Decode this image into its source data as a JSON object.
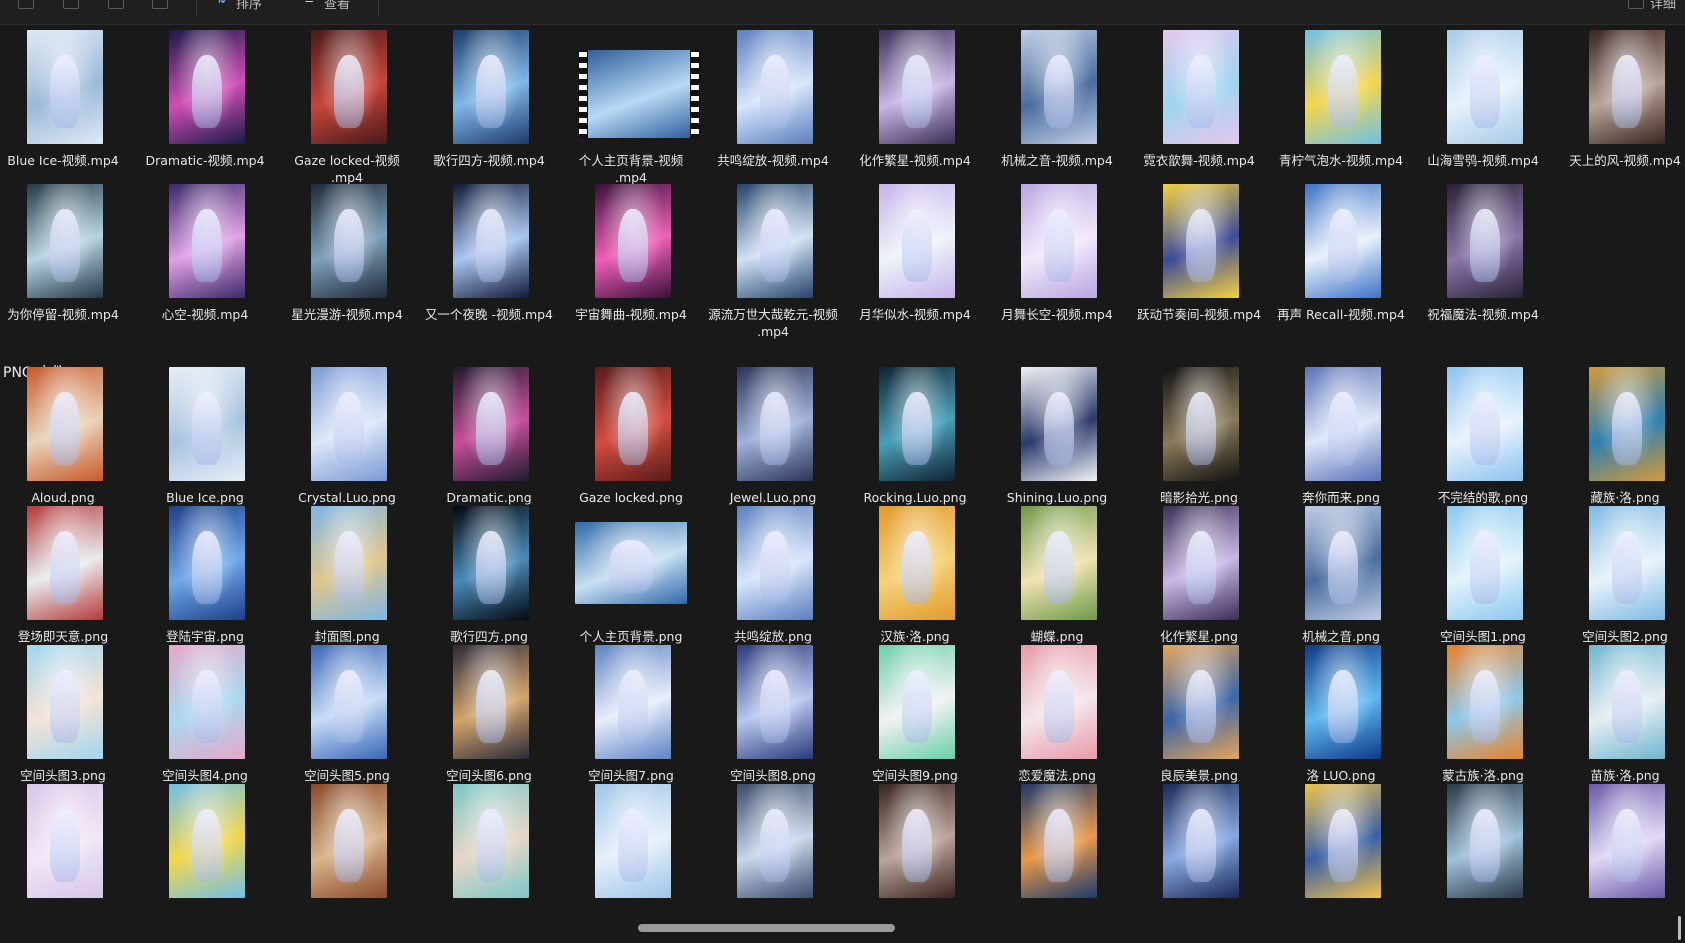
{
  "toolbar": {
    "sort_label": "排序",
    "view_label": "查看",
    "details_label": "详细"
  },
  "groups": {
    "png_header": "PNG 文件"
  },
  "mp4_files": [
    {
      "name": "Blue Ice-视频.mp4",
      "colors": [
        "#dfe9f5",
        "#9ab8d8"
      ]
    },
    {
      "name": "Dramatic-视频.mp4",
      "colors": [
        "#1a1a4a",
        "#d04fb5"
      ]
    },
    {
      "name": "Gaze locked-视频.mp4",
      "colors": [
        "#4a1a1a",
        "#c7453a"
      ]
    },
    {
      "name": "歌行四方-视频.mp4",
      "colors": [
        "#1d3b6b",
        "#7fb7e8"
      ]
    },
    {
      "name": "个人主页背景-视频.mp4",
      "colors": [
        "#2f5f9a",
        "#b9d9f5"
      ]
    },
    {
      "name": "共鸣绽放-视频.mp4",
      "colors": [
        "#5b7fc0",
        "#d7e6fb"
      ]
    },
    {
      "name": "化作繁星-视频.mp4",
      "colors": [
        "#3a2f55",
        "#c9b7e6"
      ]
    },
    {
      "name": "机械之音-视频.mp4",
      "colors": [
        "#bfcde6",
        "#4a6c9e"
      ]
    },
    {
      "name": "霓衣歆舞-视频.mp4",
      "colors": [
        "#e4c7ee",
        "#9fd4ef"
      ]
    },
    {
      "name": "青柠气泡水-视频.mp4",
      "colors": [
        "#6fc0ea",
        "#f4d64a"
      ]
    },
    {
      "name": "山海雪鸮-视频.mp4",
      "colors": [
        "#a8cbe8",
        "#e6f2fb"
      ]
    },
    {
      "name": "天上的风-视频.mp4",
      "colors": [
        "#3a2420",
        "#b9a49a"
      ]
    },
    {
      "name": "为你停留-视频.mp4",
      "colors": [
        "#243947",
        "#b6d3df"
      ]
    },
    {
      "name": "心空-视频.mp4",
      "colors": [
        "#3b2a6a",
        "#e1a0e6"
      ]
    },
    {
      "name": "星光漫游-视频.mp4",
      "colors": [
        "#1e2a3a",
        "#7fa0b9"
      ]
    },
    {
      "name": "又一个夜晚 -视频.mp4",
      "colors": [
        "#101a38",
        "#a9c5f0"
      ]
    },
    {
      "name": "宇宙舞曲-视频.mp4",
      "colors": [
        "#3a0f3a",
        "#ef5fb6"
      ]
    },
    {
      "name": "源流万世大哉乾元-视频.mp4",
      "colors": [
        "#25446b",
        "#cfe2f3"
      ]
    },
    {
      "name": "月华似水-视频.mp4",
      "colors": [
        "#c6b3ea",
        "#eef3fb"
      ]
    },
    {
      "name": "月舞长空-视频.mp4",
      "colors": [
        "#b9a6e0",
        "#f1e9fb"
      ]
    },
    {
      "name": "跃动节奏间-视频.mp4",
      "colors": [
        "#f5d23c",
        "#3b4a9a"
      ]
    },
    {
      "name": "再声 Recall-视频.mp4",
      "colors": [
        "#3d73c6",
        "#e8f0fb"
      ]
    },
    {
      "name": "祝福魔法-视频.mp4",
      "colors": [
        "#2a2238",
        "#8a76a8"
      ]
    }
  ],
  "png_files": [
    {
      "name": "Aloud.png",
      "colors": [
        "#c85a2a",
        "#e8d2b8"
      ]
    },
    {
      "name": "Blue Ice.png",
      "colors": [
        "#e6eef7",
        "#a9c3df"
      ]
    },
    {
      "name": "Crystal.Luo.png",
      "colors": [
        "#7c9ad6",
        "#dce7f7"
      ]
    },
    {
      "name": "Dramatic.png",
      "colors": [
        "#1f1a2e",
        "#c64f9a"
      ]
    },
    {
      "name": "Gaze locked.png",
      "colors": [
        "#5a1a1a",
        "#d34c40"
      ]
    },
    {
      "name": "Jewel.Luo.png",
      "colors": [
        "#2c3558",
        "#9fb2d9"
      ]
    },
    {
      "name": "Rocking.Luo.png",
      "colors": [
        "#102231",
        "#4aa0b9"
      ]
    },
    {
      "name": "Shining.Luo.png",
      "colors": [
        "#f1f3f8",
        "#2a3a6a"
      ]
    },
    {
      "name": "暗影拾光.png",
      "colors": [
        "#121212",
        "#8a7a5a"
      ]
    },
    {
      "name": "奔你而来.png",
      "colors": [
        "#5a72b9",
        "#dde6f7"
      ]
    },
    {
      "name": "不完结的歌.png",
      "colors": [
        "#8cc2f0",
        "#e8f3fc"
      ]
    },
    {
      "name": "藏族·洛.png",
      "colors": [
        "#d49a3a",
        "#2f7fb0"
      ]
    },
    {
      "name": "登场即天意.png",
      "colors": [
        "#b53a3a",
        "#e8ecef"
      ]
    },
    {
      "name": "登陆宇宙.png",
      "colors": [
        "#1e3f8a",
        "#6fa8e8"
      ]
    },
    {
      "name": "封面图.png",
      "colors": [
        "#7fb6e6",
        "#e0c58a"
      ]
    },
    {
      "name": "歌行四方.png",
      "colors": [
        "#04080f",
        "#4a8ab9"
      ]
    },
    {
      "name": "个人主页背景.png",
      "colors": [
        "#2f69ab",
        "#c8dff2"
      ]
    },
    {
      "name": "共鸣绽放.png",
      "colors": [
        "#5b7fc0",
        "#d7e6fb"
      ]
    },
    {
      "name": "汉族·洛.png",
      "colors": [
        "#e49a2a",
        "#f3d27a"
      ]
    },
    {
      "name": "蝴蝶.png",
      "colors": [
        "#6e9a4a",
        "#f1e2b0"
      ]
    },
    {
      "name": "化作繁星.png",
      "colors": [
        "#3a2f55",
        "#c9b7e6"
      ]
    },
    {
      "name": "机械之音.png",
      "colors": [
        "#bfcde6",
        "#4a6c9e"
      ]
    },
    {
      "name": "空间头图1.png",
      "colors": [
        "#8cc8ef",
        "#e3f3fc"
      ]
    },
    {
      "name": "空间头图2.png",
      "colors": [
        "#7fb9e3",
        "#e8f3fa"
      ]
    },
    {
      "name": "空间头图3.png",
      "colors": [
        "#9fd6ef",
        "#f6e2d6"
      ]
    },
    {
      "name": "空间头图4.png",
      "colors": [
        "#e6a8c8",
        "#a8d8ef"
      ]
    },
    {
      "name": "空间头图5.png",
      "colors": [
        "#3a66b9",
        "#c6dbf5"
      ]
    },
    {
      "name": "空间头图6.png",
      "colors": [
        "#2a2a3a",
        "#d4a46a"
      ]
    },
    {
      "name": "空间头图7.png",
      "colors": [
        "#5e82c6",
        "#e8eefa"
      ]
    },
    {
      "name": "空间头图8.png",
      "colors": [
        "#2a3a7a",
        "#b8c8f0"
      ]
    },
    {
      "name": "空间头图9.png",
      "colors": [
        "#6ad0a8",
        "#f2f2f2"
      ]
    },
    {
      "name": "恋爱魔法.png",
      "colors": [
        "#e89aa8",
        "#f3e6ea"
      ]
    },
    {
      "name": "良辰美景.png",
      "colors": [
        "#e6a45a",
        "#3a66a8"
      ]
    },
    {
      "name": "洛 LUO.png",
      "colors": [
        "#0f3a8a",
        "#5fb8ef"
      ]
    },
    {
      "name": "蒙古族·洛.png",
      "colors": [
        "#e8832a",
        "#8cc8ea"
      ]
    },
    {
      "name": "苗族·洛.png",
      "colors": [
        "#6fb6d0",
        "#e6eef2"
      ]
    },
    {
      "name": "",
      "colors": [
        "#d8c6ea",
        "#f1e6f5"
      ]
    },
    {
      "name": "",
      "colors": [
        "#6fc0ea",
        "#f4d64a"
      ]
    },
    {
      "name": "",
      "colors": [
        "#8a4a2a",
        "#d9b48a"
      ]
    },
    {
      "name": "",
      "colors": [
        "#7ec7c7",
        "#e6d6c6"
      ]
    },
    {
      "name": "",
      "colors": [
        "#9fc5e8",
        "#e6f0fa"
      ]
    },
    {
      "name": "",
      "colors": [
        "#3a4a6a",
        "#c8d8ea"
      ]
    },
    {
      "name": "",
      "colors": [
        "#3a2420",
        "#b9a49a"
      ]
    },
    {
      "name": "",
      "colors": [
        "#1e3a6a",
        "#e89a4a"
      ]
    },
    {
      "name": "",
      "colors": [
        "#1a2a5a",
        "#8aa8e0"
      ]
    },
    {
      "name": "",
      "colors": [
        "#f0c24a",
        "#3a5fa8"
      ]
    },
    {
      "name": "",
      "colors": [
        "#2a3a4a",
        "#a0c0d8"
      ]
    },
    {
      "name": "",
      "colors": [
        "#6a5aa8",
        "#e0d8f5"
      ]
    }
  ]
}
